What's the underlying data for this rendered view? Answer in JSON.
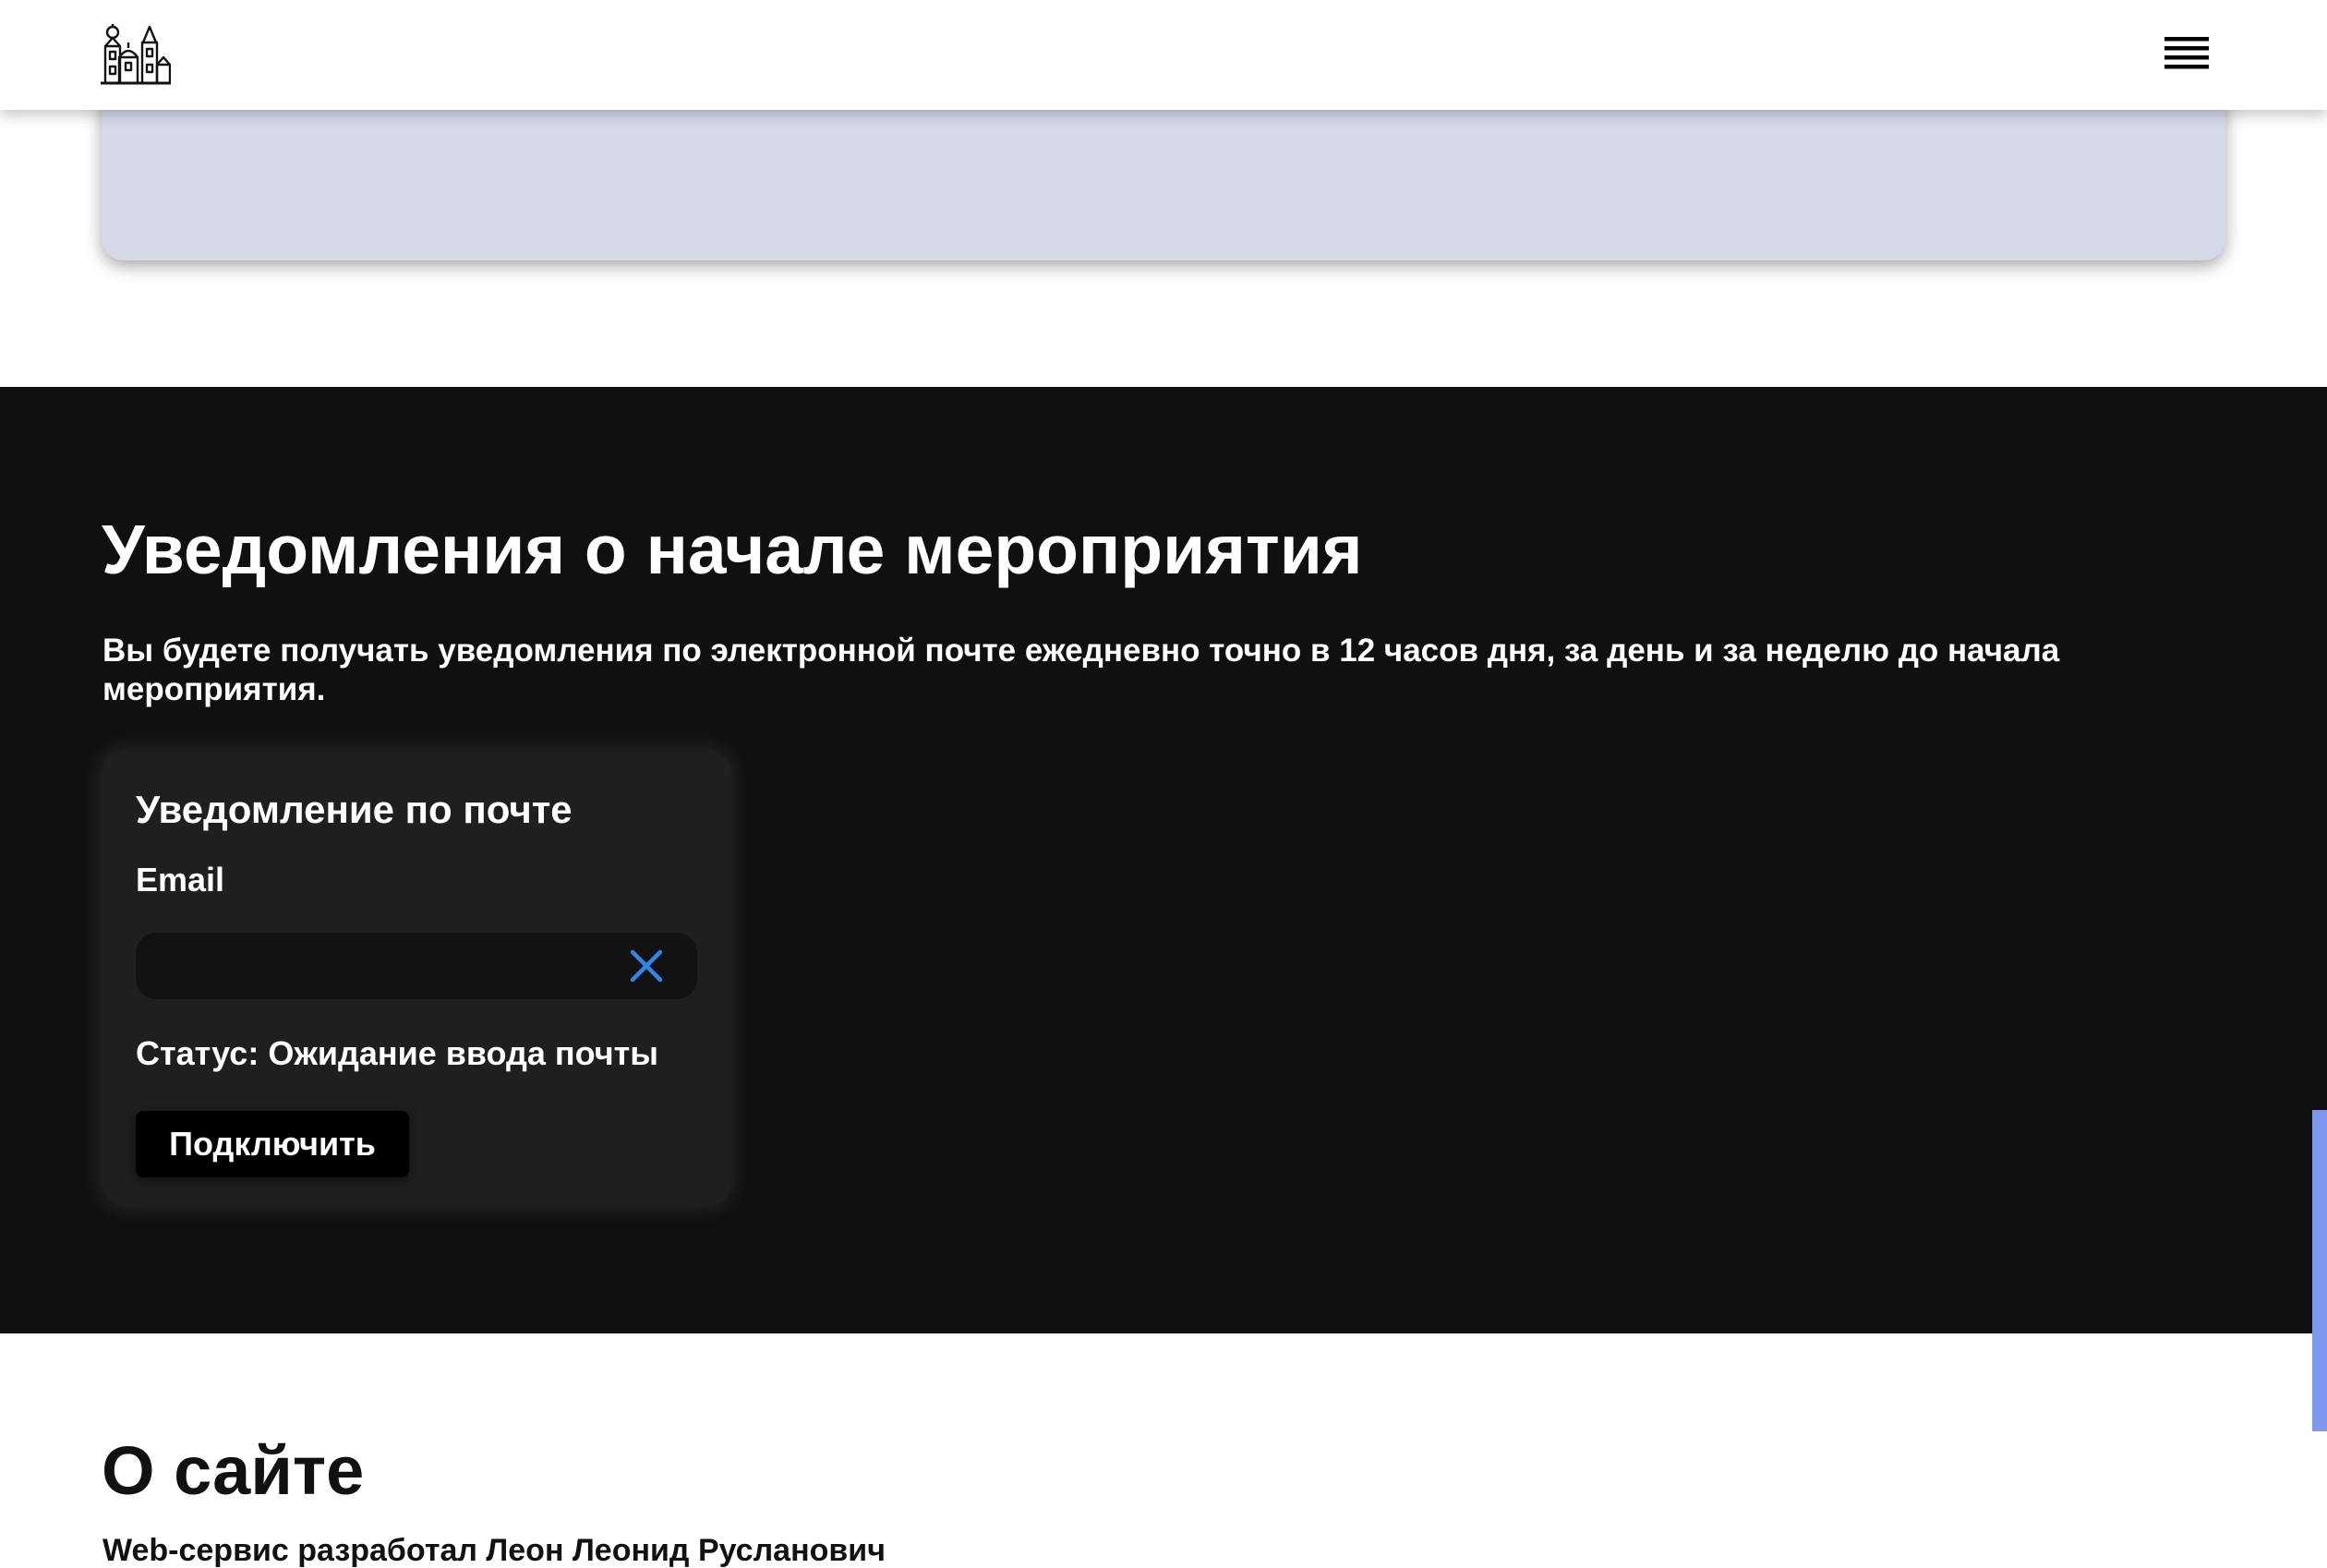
{
  "header": {
    "logo_icon": "city-castle-logo-icon",
    "menu_icon": "hamburger-menu-icon"
  },
  "notifications": {
    "title": "Уведомления о начале мероприятия",
    "description": "Вы будете получать уведомления по электронной почте ежедневно точно в 12 часов дня, за день и за неделю до начала мероприятия.",
    "card": {
      "title": "Уведомление по почте",
      "email_label": "Email",
      "email_value": "",
      "email_placeholder": "",
      "clear_icon": "close-x-icon",
      "status": "Статус: Ожидание ввода почты",
      "connect_label": "Подключить"
    }
  },
  "about": {
    "title": "О сайте",
    "text": "Web-сервис разработал Леон Леонид Русланович"
  },
  "colors": {
    "lavender_card": "#d8d9e8",
    "dark_section": "#101010",
    "card_background": "#1f1f1f",
    "input_background": "#121212",
    "clear_icon_color": "#2f86eb",
    "scroll_thumb": "#7f98ee"
  }
}
